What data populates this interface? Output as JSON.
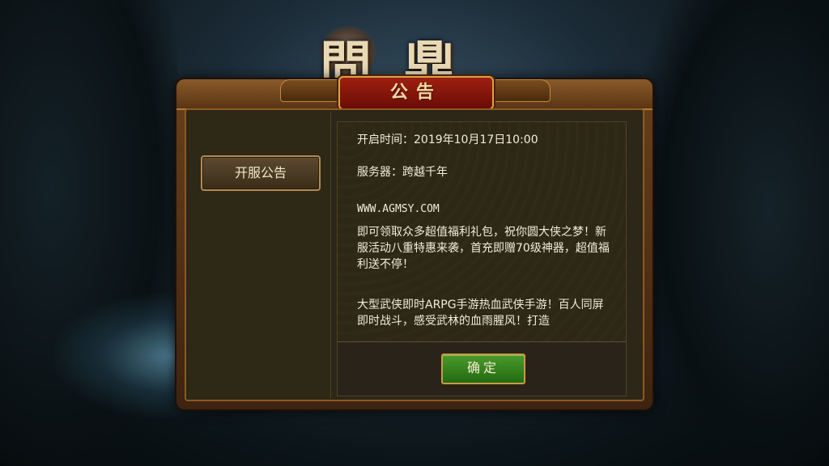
{
  "logo": {
    "text": "問鼎"
  },
  "dialog": {
    "title": "公告",
    "tabs": [
      {
        "label": "开服公告"
      }
    ],
    "content": {
      "open_time": "开启时间：2019年10月17日10:00",
      "server": "服务器：跨越千年",
      "website": "WWW.AGMSY.COM",
      "promo": "即可领取众多超值福利礼包，祝你圆大侠之梦！新服活动八重特惠来袭，首充即赠70级神器，超值福利送不停！",
      "intro": "大型武侠即时ARPG手游热血武侠手游！百人同屏即时战斗，感受武林的血雨腥风！打造"
    },
    "confirm_label": "确定"
  },
  "colors": {
    "frame": "#6a3f1a",
    "panel": "#2c2717",
    "title_banner": "#9e2010",
    "confirm_button": "#3f8a24",
    "text": "#f2ecd8"
  }
}
